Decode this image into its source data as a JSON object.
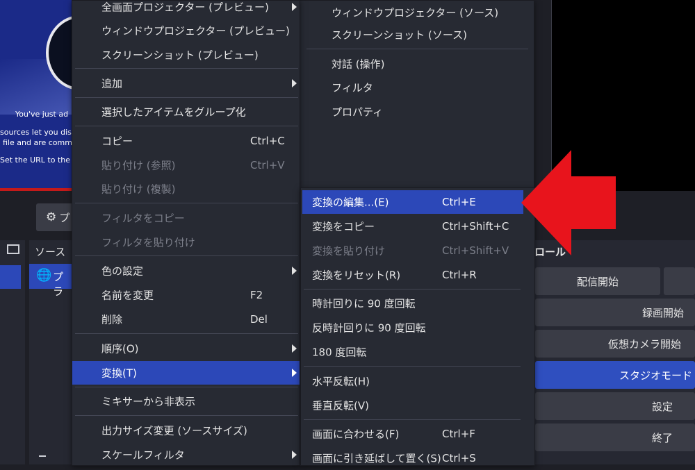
{
  "preview": {
    "line1": "You've just ad",
    "line2": "sources let you dis",
    "line3": "file and are comm",
    "line4": "Set the URL to the"
  },
  "toolbar": {
    "props_label": "プ"
  },
  "sources_panel": {
    "title": "ソース",
    "item_label": "プラ"
  },
  "controls_panel": {
    "title": "ロール",
    "buttons": [
      "配信開始",
      "録画開始",
      "仮想カメラ開始",
      "スタジオモード",
      "設定",
      "終了"
    ]
  },
  "context_menu": {
    "items": [
      "全画面プロジェクター (プレビュー)",
      "ウィンドウプロジェクター (プレビュー)",
      "スクリーンショット (プレビュー)",
      "追加",
      "選択したアイテムをグループ化",
      "コピー",
      "貼り付け (参照)",
      "貼り付け (複製)",
      "フィルタをコピー",
      "フィルタを貼り付け",
      "色の設定",
      "名前を変更",
      "削除",
      "順序(O)",
      "変換(T)",
      "ミキサーから非表示",
      "出力サイズ変更 (ソースサイズ)",
      "スケールフィルタ"
    ],
    "shortcuts": {
      "copy": "Ctrl+C",
      "paste_ref": "Ctrl+V",
      "rename": "F2",
      "delete": "Del"
    }
  },
  "upper_submenu": {
    "items": [
      "ウィンドウプロジェクター (ソース)",
      "スクリーンショット (ソース)",
      "対話 (操作)",
      "フィルタ",
      "プロパティ"
    ]
  },
  "transform_submenu": {
    "items": [
      "変換の編集...(E)",
      "変換をコピー",
      "変換を貼り付け",
      "変換をリセット(R)",
      "時計回りに 90 度回転",
      "反時計回りに 90 度回転",
      "180 度回転",
      "水平反転(H)",
      "垂直反転(V)",
      "画面に合わせる(F)",
      "画面に引き延ばして置く(S)"
    ],
    "shortcuts": [
      "Ctrl+E",
      "Ctrl+Shift+C",
      "Ctrl+Shift+V",
      "Ctrl+R",
      "Ctrl+F",
      "Ctrl+S"
    ]
  },
  "colors": {
    "highlight": "#2c48b8",
    "arrow": "#e8141c",
    "menu_bg": "#272a33"
  },
  "icons": [
    "gear-icon",
    "globe-icon",
    "arrow-pointer-icon",
    "submenu-arrow-icon"
  ]
}
